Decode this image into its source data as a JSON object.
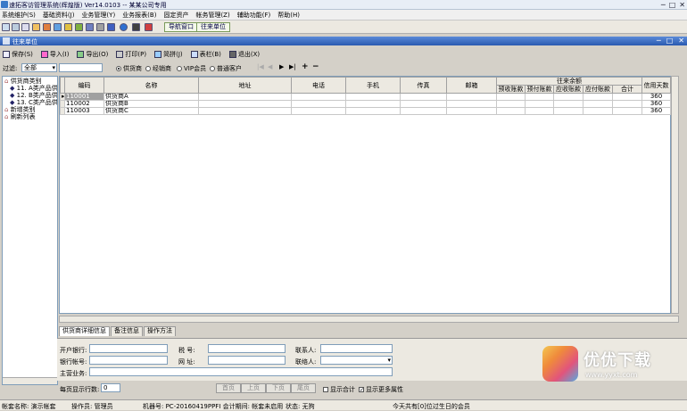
{
  "window": {
    "title": "速拓客访管理系统(辉煌版) Ver14.0103 -- 某某公司专用"
  },
  "menu": [
    "系统维护(S)",
    "基础资料(J)",
    "业务管理(Y)",
    "业务报表(B)",
    "固定资产",
    "帐务管理(Z)",
    "辅助功能(F)",
    "帮助(H)"
  ],
  "quick": {
    "nav_label": "导航窗口",
    "contact_label": "往来单位"
  },
  "mdi": {
    "title": "往来单位"
  },
  "toolbar": [
    "保存(S)",
    "导入(I)",
    "导出(O)",
    "打印(P)",
    "简拼(J)",
    "表栏(B)",
    "退出(X)"
  ],
  "filter": {
    "label": "过滤:",
    "value": "全部",
    "options": [
      "供货商",
      "经销商",
      "VIP会员",
      "普通客户"
    ],
    "selected": "供货商"
  },
  "tree": [
    "供货商类别",
    "11. A类产品供",
    "12. B类产品供",
    "13. C类产品供",
    "新增类别",
    "刷新列表"
  ],
  "grid": {
    "columns": [
      "编码",
      "名称",
      "地址",
      "电话",
      "手机",
      "传真",
      "邮箱",
      "往来余额",
      "信用天数"
    ],
    "balance_sub": [
      "预收账款",
      "预付账款",
      "应收账款",
      "应付账款",
      "合计"
    ],
    "rows": [
      {
        "code": "110001",
        "name": "供货商A",
        "days": "360"
      },
      {
        "code": "110002",
        "name": "供货商B",
        "days": "360"
      },
      {
        "code": "110003",
        "name": "供货商C",
        "days": "360"
      }
    ]
  },
  "tabs": [
    "供货商详细信息",
    "备注信息",
    "操作方法"
  ],
  "detail": {
    "bank": "开户银行:",
    "taxno": "税    号:",
    "contact": "联系人:",
    "account": "银行帐号:",
    "url": "网    址:",
    "person": "联络人:",
    "business": "主营业务:"
  },
  "pager": {
    "rows_label": "每页显示行数:",
    "rows_value": "0",
    "buttons": [
      "首页",
      "上页",
      "下页",
      "尾页"
    ],
    "show_total": "显示合计",
    "show_more": "显示更多属性"
  },
  "status": {
    "account": "帐套名称: 演示帐套",
    "operator": "操作员: 管理员",
    "machine": "机器号: PC-20160419PPFI 会计期间: 帐套未启用",
    "state": "状态: 无狗",
    "birthday": "今天共有[0]位过生日的会员"
  },
  "watermark": {
    "text": "优优下载",
    "url": "www.yyxt.com"
  }
}
